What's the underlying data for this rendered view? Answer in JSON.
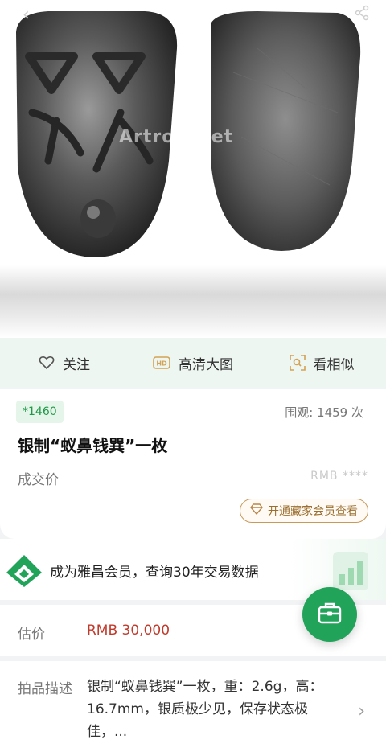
{
  "hero": {
    "watermark": "Artron.Net",
    "icons": [
      "back-icon",
      "share-icon"
    ]
  },
  "actions": {
    "follow": {
      "label": "关注",
      "icon": "heart-outline-icon"
    },
    "hd": {
      "label": "高清大图",
      "icon": "hd-icon",
      "icon_text": "HD"
    },
    "similar": {
      "label": "看相似",
      "icon": "scan-search-icon"
    }
  },
  "lot": {
    "badge": "*1460",
    "views": "围观: 1459 次",
    "title": "银制“蚁鼻钱巽”一枚",
    "deal_label": "成交价",
    "deal_price": "RMB ****",
    "vip_button": "开通藏家会员查看"
  },
  "banner": {
    "text": "成为雅昌会员，查询30年交易数据"
  },
  "estimate": {
    "label": "估价",
    "value": "RMB  30,000"
  },
  "description": {
    "label": "拍品描述",
    "text": "银制“蚁鼻钱巽”一枚，重：2.6g，高：16.7mm，银质极少见，保存状态极佳，..."
  },
  "colors": {
    "brand_green": "#22a35a",
    "price_red": "#c03a2b",
    "vip_gold": "#9b6e2f"
  }
}
